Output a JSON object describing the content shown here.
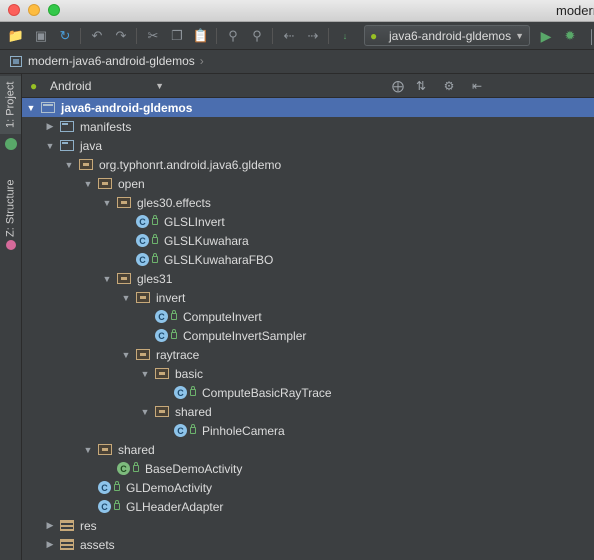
{
  "window": {
    "title": "modern"
  },
  "toolbar": {
    "run_config": "java6-android-gldemos"
  },
  "breadcrumb": {
    "project": "modern-java6-android-gldemos"
  },
  "left_strip": {
    "project_tab": "1: Project",
    "structure_tab": "Z: Structure"
  },
  "project_view": {
    "selector": "Android"
  },
  "tree": [
    {
      "label": "java6-android-gldemos",
      "depth": 0,
      "icon": "module",
      "expanded": true,
      "selected": true
    },
    {
      "label": "manifests",
      "depth": 1,
      "icon": "folder",
      "expanded": false
    },
    {
      "label": "java",
      "depth": 1,
      "icon": "folder",
      "expanded": true
    },
    {
      "label": "org.typhonrt.android.java6.gldemo",
      "depth": 2,
      "icon": "package",
      "expanded": true
    },
    {
      "label": "open",
      "depth": 3,
      "icon": "package",
      "expanded": true
    },
    {
      "label": "gles30.effects",
      "depth": 4,
      "icon": "package",
      "expanded": true
    },
    {
      "label": "GLSLInvert",
      "depth": 5,
      "icon": "class",
      "leaf": true
    },
    {
      "label": "GLSLKuwahara",
      "depth": 5,
      "icon": "class",
      "leaf": true
    },
    {
      "label": "GLSLKuwaharaFBO",
      "depth": 5,
      "icon": "class",
      "leaf": true
    },
    {
      "label": "gles31",
      "depth": 4,
      "icon": "package",
      "expanded": true
    },
    {
      "label": "invert",
      "depth": 5,
      "icon": "package",
      "expanded": true
    },
    {
      "label": "ComputeInvert",
      "depth": 6,
      "icon": "class",
      "leaf": true
    },
    {
      "label": "ComputeInvertSampler",
      "depth": 6,
      "icon": "class",
      "leaf": true
    },
    {
      "label": "raytrace",
      "depth": 5,
      "icon": "package",
      "expanded": true
    },
    {
      "label": "basic",
      "depth": 6,
      "icon": "package",
      "expanded": true
    },
    {
      "label": "ComputeBasicRayTrace",
      "depth": 7,
      "icon": "class",
      "leaf": true
    },
    {
      "label": "shared",
      "depth": 6,
      "icon": "package",
      "expanded": true
    },
    {
      "label": "PinholeCamera",
      "depth": 7,
      "icon": "class",
      "leaf": true
    },
    {
      "label": "shared",
      "depth": 3,
      "icon": "package",
      "expanded": true
    },
    {
      "label": "BaseDemoActivity",
      "depth": 4,
      "icon": "class-green",
      "leaf": true
    },
    {
      "label": "GLDemoActivity",
      "depth": 3,
      "icon": "class",
      "leaf": true
    },
    {
      "label": "GLHeaderAdapter",
      "depth": 3,
      "icon": "class",
      "leaf": true
    },
    {
      "label": "res",
      "depth": 1,
      "icon": "res",
      "expanded": false
    },
    {
      "label": "assets",
      "depth": 1,
      "icon": "res",
      "expanded": false
    }
  ]
}
